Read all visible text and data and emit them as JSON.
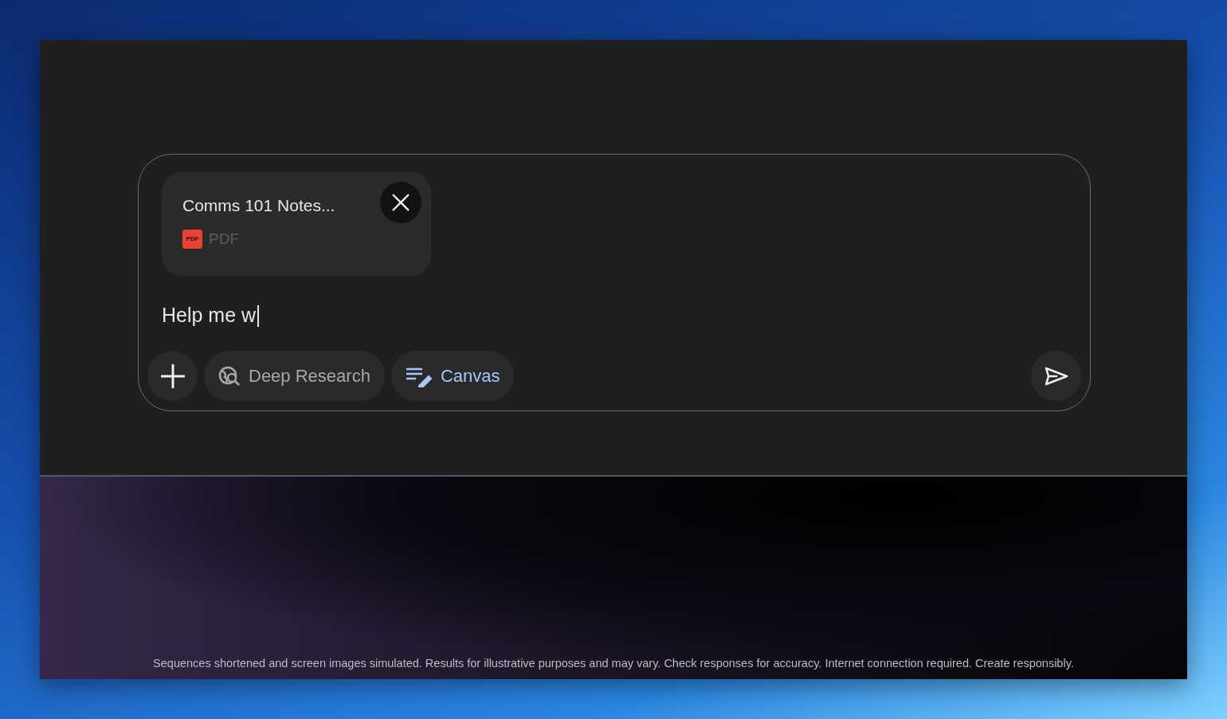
{
  "composer": {
    "attachment": {
      "name": "Comms 101 Notes...",
      "badge": "PDF",
      "type": "PDF"
    },
    "input": {
      "value": "Help me w",
      "focused": true
    },
    "tools": [
      {
        "label": "Deep Research",
        "kind": "research",
        "selected": false
      },
      {
        "label": "Canvas",
        "kind": "canvas",
        "selected": true
      }
    ]
  },
  "disclaimer": "Sequences shortened and screen images simulated. Results for illustrative purposes and may vary. Check responses for accuracy. Internet connection required. Create responsibly."
}
